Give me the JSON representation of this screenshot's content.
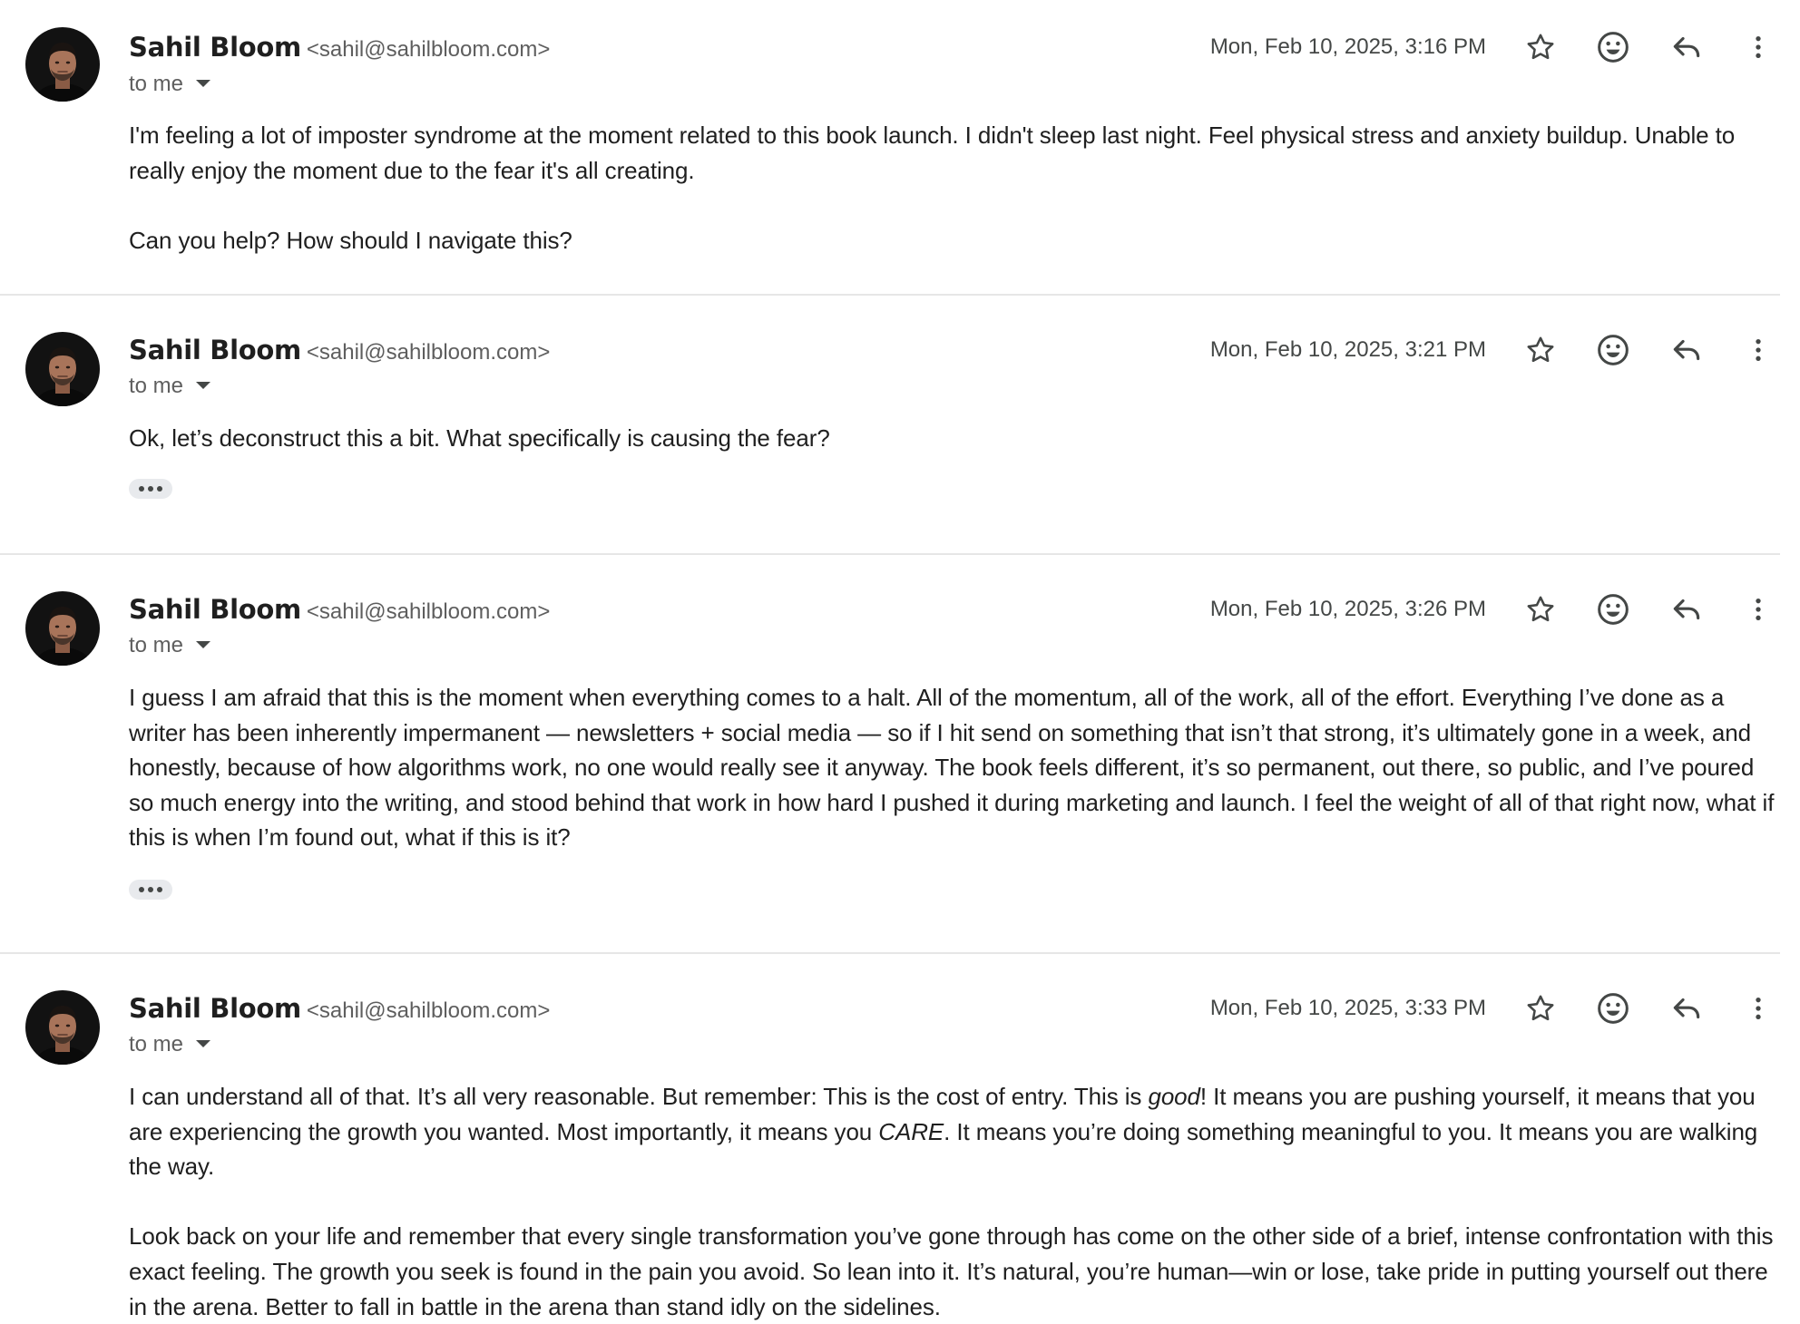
{
  "messages": [
    {
      "sender_name": "Sahil Bloom",
      "sender_email": "<sahil@sahilbloom.com>",
      "recipient_label": "to me",
      "date": "Mon, Feb 10, 2025, 3:16 PM",
      "paragraphs": [
        "I'm feeling a lot of imposter syndrome at the moment related to this book launch. I didn't sleep last night. Feel physical stress and anxiety buildup. Unable to really enjoy the moment due to the fear it's all creating.",
        "Can you help? How should I navigate this?"
      ],
      "has_trimmed_content": false
    },
    {
      "sender_name": "Sahil Bloom",
      "sender_email": "<sahil@sahilbloom.com>",
      "recipient_label": "to me",
      "date": "Mon, Feb 10, 2025, 3:21 PM",
      "paragraphs": [
        "Ok, let’s deconstruct this a bit. What specifically is causing the fear?"
      ],
      "has_trimmed_content": true
    },
    {
      "sender_name": "Sahil Bloom",
      "sender_email": "<sahil@sahilbloom.com>",
      "recipient_label": "to me",
      "date": "Mon, Feb 10, 2025, 3:26 PM",
      "paragraphs": [
        "I guess I am afraid that this is the moment when everything comes to a halt. All of the momentum, all of the work, all of the effort. Everything I’ve done as a writer has been inherently impermanent — newsletters + social media — so if I hit send on something that isn’t that strong, it’s ultimately gone in a week, and honestly, because of how algorithms work, no one would really see it anyway. The book feels different, it’s so permanent, out there, so public, and I’ve poured so much energy into the writing, and stood behind that work in how hard I pushed it during marketing and launch. I feel the weight of all of that right now, what if this is when I’m found out, what if this is it?"
      ],
      "has_trimmed_content": true
    },
    {
      "sender_name": "Sahil Bloom",
      "sender_email": "<sahil@sahilbloom.com>",
      "recipient_label": "to me",
      "date": "Mon, Feb 10, 2025, 3:33 PM",
      "paragraph_1_parts": {
        "a": "I can understand all of that. It’s all very reasonable. But remember: This is the cost of entry. This is ",
        "b": "good",
        "c": "! It means you are pushing yourself, it means that you are experiencing the growth you wanted. Most importantly, it means you ",
        "d": "CARE",
        "e": ". It means you’re doing something meaningful to you. It means you are walking the way."
      },
      "paragraphs": [
        "Look back on your life and remember that every single transformation you’ve gone through has come on the other side of a brief, intense confrontation with this exact feeling. The growth you seek is found in the pain you avoid. So lean into it. It’s natural, you’re human—win or lose, take pride in putting yourself out there in the arena. Better to fall in battle in the arena than stand idly on the sidelines."
      ],
      "has_trimmed_content": false
    }
  ],
  "icons": {
    "star": "star-outline-icon",
    "emoji": "add-reaction-icon",
    "reply": "reply-arrow-icon",
    "more": "more-vertical-icon",
    "caret": "caret-down-icon",
    "trimmed": "show-trimmed-content-icon"
  },
  "colors": {
    "text_primary": "#1f1f1f",
    "text_secondary": "#5e5e5e",
    "icon": "#444746",
    "divider": "#e6e6e6",
    "ellipsis_bg": "#e8eaed"
  }
}
